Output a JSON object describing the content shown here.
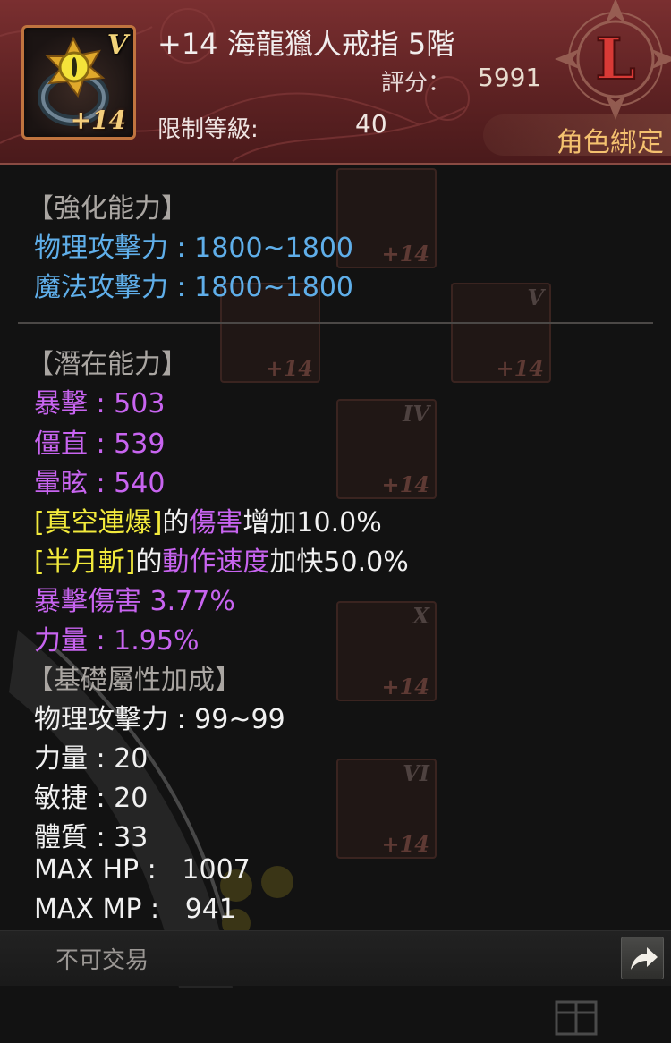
{
  "item": {
    "name": "+14 海龍獵人戒指 5階",
    "icon_name": "ring-icon",
    "icon_tier": "V",
    "icon_enhance": "+14",
    "score_label": "評分：",
    "score_value": "5991",
    "level_label": "限制等級:",
    "level_value": "40",
    "bind_label": "角色綁定",
    "rarity_letter": "L"
  },
  "sections": {
    "enhance": {
      "title": "【強化能力】",
      "lines": [
        "物理攻擊力 : 1800~1800",
        "魔法攻擊力 : 1800~1800"
      ]
    },
    "potential": {
      "title": "【潛在能力】",
      "stats": [
        "暴擊 : 503",
        "僵直 : 539",
        "暈眩 : 540"
      ],
      "skill1": {
        "skill": "[真空連爆]",
        "de": "的",
        "attr": "傷害",
        "effect": "增加10.0%"
      },
      "skill2": {
        "skill": "[半月斬]",
        "de": "的",
        "attr": "動作速度",
        "effect": "加快50.0%"
      },
      "extra": [
        "暴擊傷害 3.77%",
        "力量 : 1.95%"
      ]
    },
    "base": {
      "title": "【基礎屬性加成】",
      "lines": [
        "物理攻擊力 : 99~99",
        "力量 : 20",
        "敏捷 : 20",
        "體質 : 33",
        "MAX HP :   1007",
        "MAX MP :   941"
      ]
    }
  },
  "footer": {
    "trade_label": "不可交易",
    "share_icon": "share-arrow-icon"
  },
  "background_slots": [
    {
      "tier": "",
      "enhance": "+14"
    },
    {
      "tier": "V",
      "enhance": "+14"
    },
    {
      "tier": "",
      "enhance": "+14"
    },
    {
      "tier": "IV",
      "enhance": "+14"
    },
    {
      "tier": "X",
      "enhance": "+14"
    },
    {
      "tier": "VI",
      "enhance": "+14"
    }
  ],
  "colors": {
    "header_bg": "#5e2223",
    "enhance_text": "#5faee9",
    "potential_text": "#c864f0",
    "skill_text": "#f2ea3c",
    "base_text": "#f1f1f1",
    "bind_text": "#f4c16f",
    "rarity_letter": "#d83a36"
  }
}
